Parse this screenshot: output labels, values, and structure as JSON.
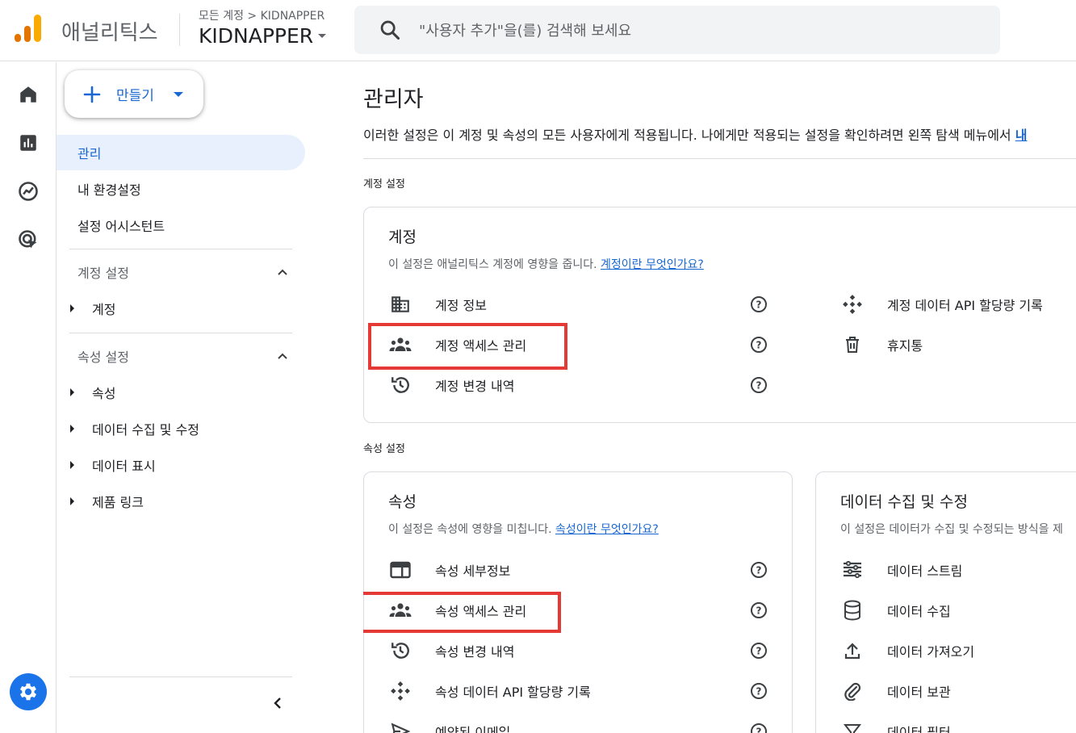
{
  "header": {
    "app_name": "애널리틱스",
    "breadcrumb": "모든 계정 > KIDNAPPER",
    "account_name": "KIDNAPPER",
    "search_placeholder": "\"사용자 추가\"을(를) 검색해 보세요"
  },
  "sidenav": {
    "create_label": "만들기",
    "items": [
      "관리",
      "내 환경설정",
      "설정 어시스턴트"
    ],
    "account_section": {
      "label": "계정 설정",
      "items": [
        "계정"
      ]
    },
    "property_section": {
      "label": "속성 설정",
      "items": [
        "속성",
        "데이터 수집 및 수정",
        "데이터 표시",
        "제품 링크"
      ]
    }
  },
  "main": {
    "title": "관리자",
    "description": "이러한 설정은 이 계정 및 속성의 모든 사용자에게 적용됩니다. 나에게만 적용되는 설정을 확인하려면 왼쪽 탐색 메뉴에서",
    "description_link": "내",
    "account_settings_label": "계정 설정",
    "property_settings_label": "속성 설정",
    "account_card": {
      "title": "계정",
      "desc": "이 설정은 애널리틱스 계정에 영향을 줍니다.",
      "link": "계정이란 무엇인가요?",
      "left_items": [
        {
          "label": "계정 정보",
          "icon": "building-icon"
        },
        {
          "label": "계정 액세스 관리",
          "icon": "people-icon"
        },
        {
          "label": "계정 변경 내역",
          "icon": "history-icon"
        }
      ],
      "right_items": [
        {
          "label": "계정 데이터 API 할당량 기록",
          "icon": "api-icon"
        },
        {
          "label": "휴지통",
          "icon": "trash-icon"
        }
      ]
    },
    "property_card": {
      "title": "속성",
      "desc": "이 설정은 속성에 영향을 미칩니다.",
      "link": "속성이란 무엇인가요?",
      "items": [
        {
          "label": "속성 세부정보",
          "icon": "property-details-icon"
        },
        {
          "label": "속성 액세스 관리",
          "icon": "people-icon"
        },
        {
          "label": "속성 변경 내역",
          "icon": "history-icon"
        },
        {
          "label": "속성 데이터 API 할당량 기록",
          "icon": "api-icon"
        },
        {
          "label": "예약된 이메일",
          "icon": "send-icon"
        }
      ]
    },
    "data_card": {
      "title": "데이터 수집 및 수정",
      "desc": "이 설정은 데이터가 수집 및 수정되는 방식을 제",
      "items": [
        {
          "label": "데이터 스트림",
          "icon": "stream-icon"
        },
        {
          "label": "데이터 수집",
          "icon": "database-icon"
        },
        {
          "label": "데이터 가져오기",
          "icon": "upload-icon"
        },
        {
          "label": "데이터 보관",
          "icon": "attachment-icon"
        },
        {
          "label": "데이터 필터",
          "icon": "filter-icon"
        }
      ]
    }
  },
  "colors": {
    "accent": "#1a73e8",
    "highlight": "#e53935",
    "active_bg": "#e8f0fe"
  }
}
